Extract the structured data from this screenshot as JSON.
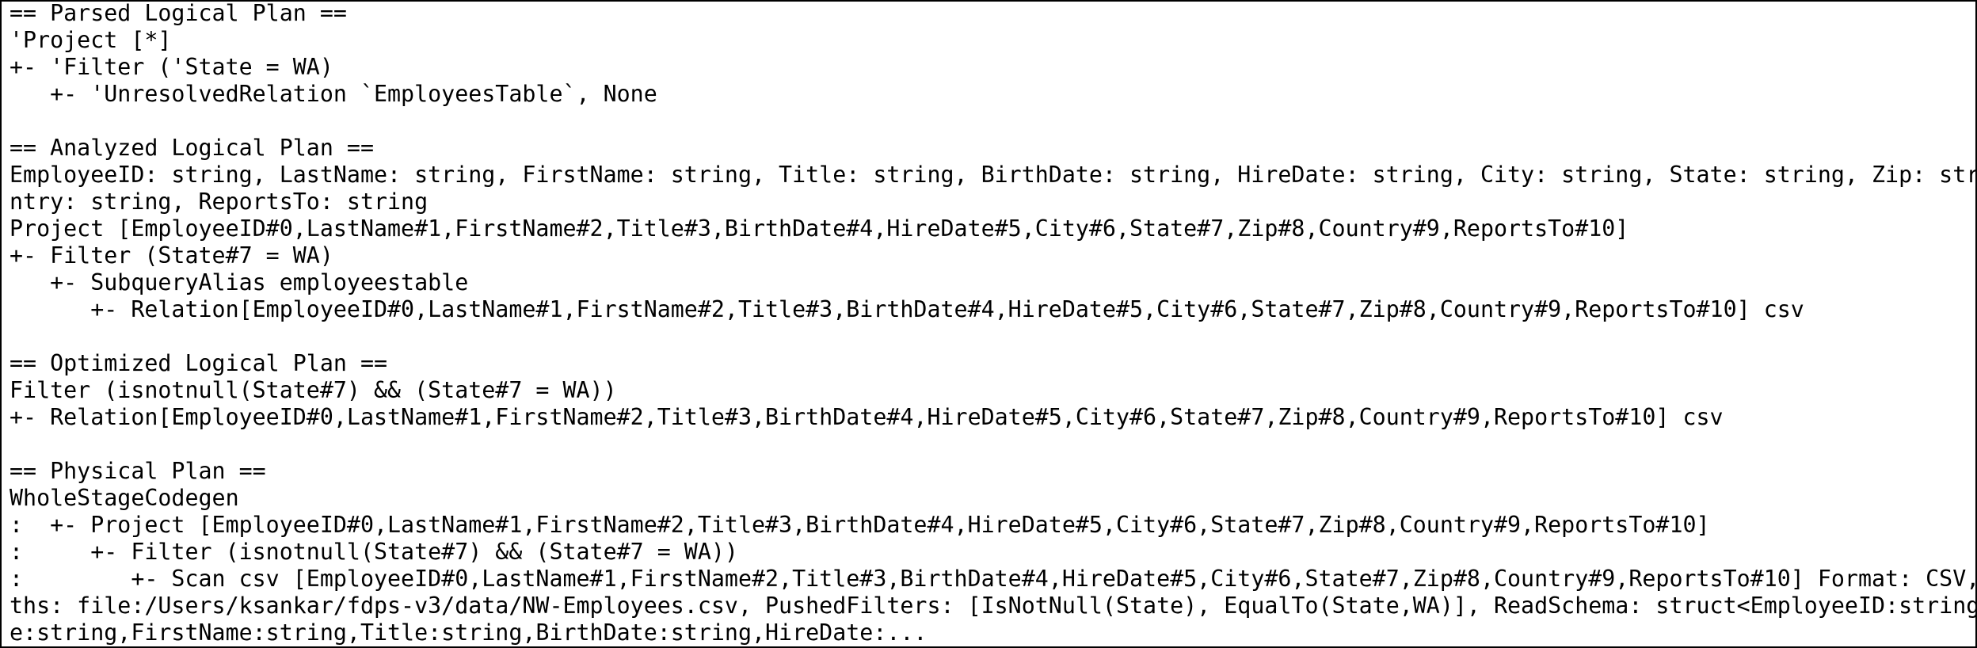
{
  "console": {
    "lines": [
      "== Parsed Logical Plan ==",
      "'Project [*]",
      "+- 'Filter ('State = WA)",
      "   +- 'UnresolvedRelation `EmployeesTable`, None",
      "",
      "== Analyzed Logical Plan ==",
      "EmployeeID: string, LastName: string, FirstName: string, Title: string, BirthDate: string, HireDate: string, City: string, State: string, Zip: string, Cou",
      "ntry: string, ReportsTo: string",
      "Project [EmployeeID#0,LastName#1,FirstName#2,Title#3,BirthDate#4,HireDate#5,City#6,State#7,Zip#8,Country#9,ReportsTo#10]",
      "+- Filter (State#7 = WA)",
      "   +- SubqueryAlias employeestable",
      "      +- Relation[EmployeeID#0,LastName#1,FirstName#2,Title#3,BirthDate#4,HireDate#5,City#6,State#7,Zip#8,Country#9,ReportsTo#10] csv",
      "",
      "== Optimized Logical Plan ==",
      "Filter (isnotnull(State#7) && (State#7 = WA))",
      "+- Relation[EmployeeID#0,LastName#1,FirstName#2,Title#3,BirthDate#4,HireDate#5,City#6,State#7,Zip#8,Country#9,ReportsTo#10] csv",
      "",
      "== Physical Plan ==",
      "WholeStageCodegen",
      ":  +- Project [EmployeeID#0,LastName#1,FirstName#2,Title#3,BirthDate#4,HireDate#5,City#6,State#7,Zip#8,Country#9,ReportsTo#10]",
      ":     +- Filter (isnotnull(State#7) && (State#7 = WA))",
      ":        +- Scan csv [EmployeeID#0,LastName#1,FirstName#2,Title#3,BirthDate#4,HireDate#5,City#6,State#7,Zip#8,Country#9,ReportsTo#10] Format: CSV, InputPa",
      "ths: file:/Users/ksankar/fdps-v3/data/NW-Employees.csv, PushedFilters: [IsNotNull(State), EqualTo(State,WA)], ReadSchema: struct<EmployeeID:string,LastNam",
      "e:string,FirstName:string,Title:string,BirthDate:string,HireDate:..."
    ]
  }
}
